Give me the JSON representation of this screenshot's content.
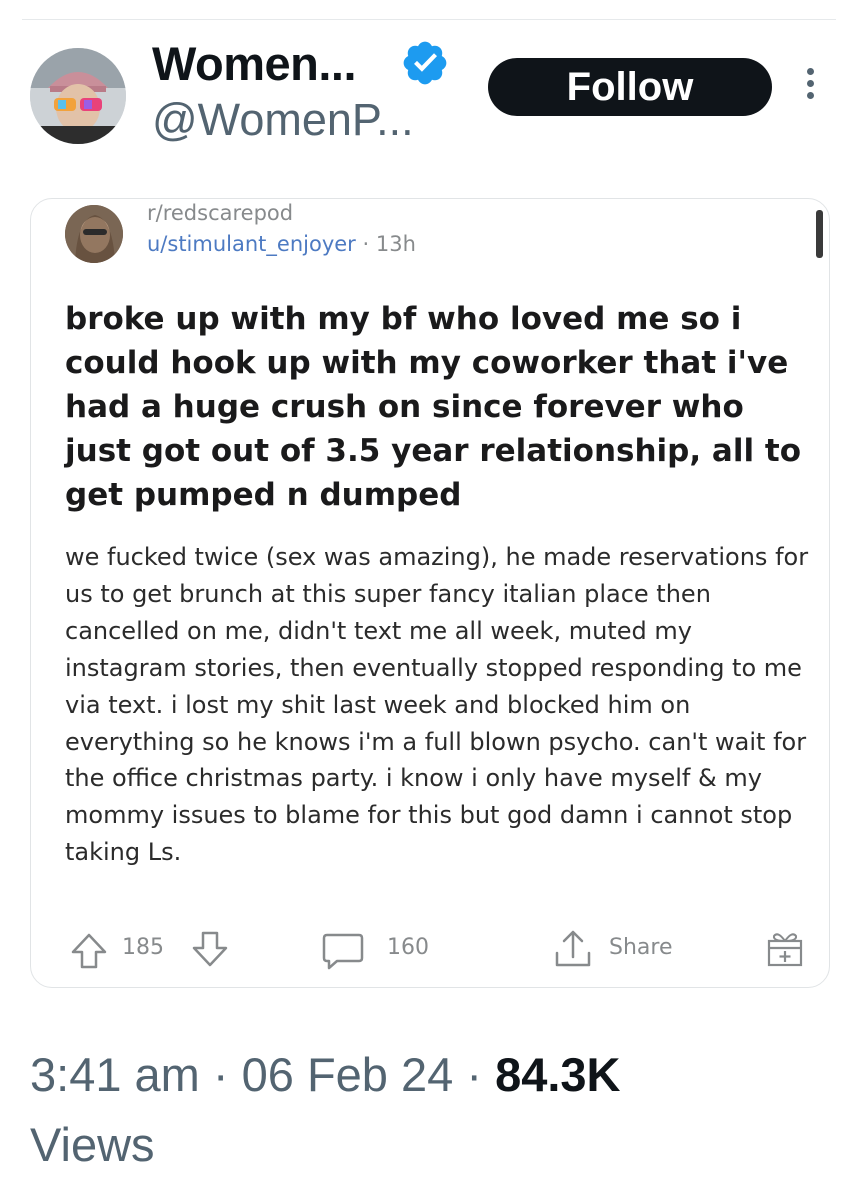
{
  "tweet": {
    "author": {
      "display_name": "Women...",
      "handle": "@WomenP...",
      "verified": true,
      "verified_color": "#1d9bf0"
    },
    "follow_label": "Follow",
    "more_icon": "more-vertical-icon",
    "embedded_post": {
      "subreddit": "r/redscarepod",
      "username": "u/stimulant_enjoyer",
      "separator": "·",
      "age": "13h",
      "title": "broke up with my bf who loved me so i could hook up with my coworker that i've had a huge crush on since forever who just got out of 3.5 year relationship, all to get pumped n dumped",
      "body": "we fucked twice (sex was amazing), he made reservations for us to get brunch at this super fancy italian place then cancelled on me, didn't text me all week, muted my instagram stories, then eventually stopped responding to me via text. i lost my shit last week and blocked him on everything so he knows i'm a full blown psycho. can't wait for the office christmas party. i know i only have myself & my mommy issues to blame for this but god damn i cannot stop taking Ls.",
      "votes": "185",
      "comments": "160",
      "share_label": "Share"
    },
    "timestamp": {
      "time": "3:41 am",
      "date": "06 Feb 24",
      "separator": "·",
      "views_count": "84.3K",
      "views_label": "Views"
    }
  },
  "colors": {
    "text_primary": "#0f1419",
    "text_secondary": "#536471",
    "follow_bg": "#0f1419",
    "reddit_username": "#4d7ac2",
    "reddit_meta": "#878a8c"
  }
}
